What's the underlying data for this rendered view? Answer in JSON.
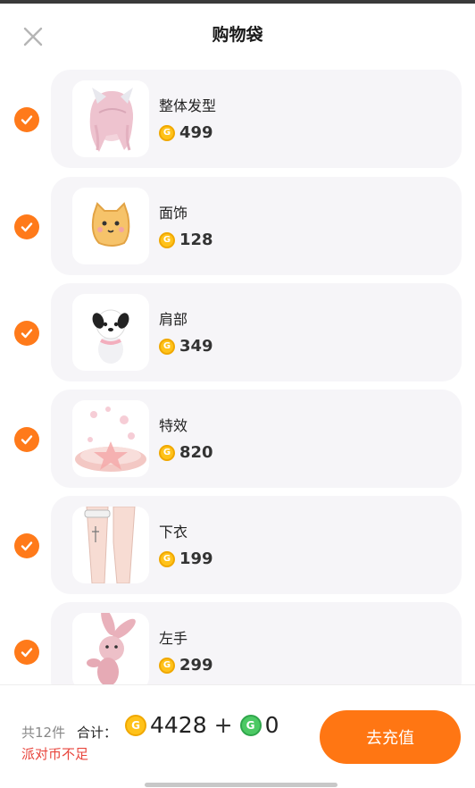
{
  "header": {
    "title": "购物袋"
  },
  "items": [
    {
      "name": "整体发型",
      "price": "499",
      "thumb": "hair-thumbnail"
    },
    {
      "name": "面饰",
      "price": "128",
      "thumb": "cat-face-thumbnail"
    },
    {
      "name": "肩部",
      "price": "349",
      "thumb": "panda-thumbnail"
    },
    {
      "name": "特效",
      "price": "820",
      "thumb": "sakura-effect-thumbnail"
    },
    {
      "name": "下衣",
      "price": "199",
      "thumb": "legs-thumbnail"
    },
    {
      "name": "左手",
      "price": "299",
      "thumb": "bunny-thumbnail"
    }
  ],
  "footer": {
    "count": "共12件",
    "total_label": "合计：",
    "coin_total": "4428",
    "plus": "+",
    "green_total": "0",
    "warning": "派对币不足",
    "recharge_label": "去充值"
  },
  "colors": {
    "accent": "#ff7613",
    "check": "#ff7a1a",
    "warning": "#e8453c",
    "coin": "#ffc21a",
    "green_coin": "#4cc964",
    "card_bg": "#f6f5f8"
  }
}
